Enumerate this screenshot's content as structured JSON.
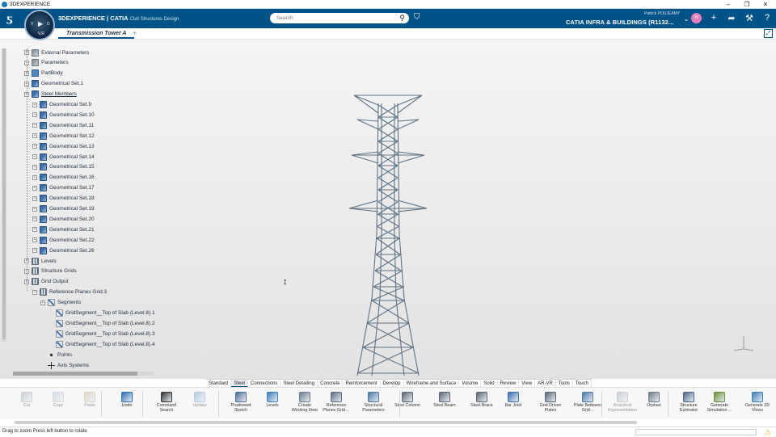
{
  "window": {
    "title": "3DEXPERIENCE",
    "minimize": "–",
    "restore": "❐",
    "close": "✕"
  },
  "header": {
    "brand": "3DEXPERIENCE | CATIA",
    "brand_sub": "Civil Structures Design",
    "search_placeholder": "Search",
    "user_name": "Patrick POUJEAMY",
    "app_name": "CATIA INFRA & BUILDINGS (R1132...",
    "avatar_initials": "H",
    "compass": {
      "left": "V",
      "right": "D",
      "bottom": "V,R"
    }
  },
  "tabs": {
    "document": "Transmission Tower A",
    "add": "+"
  },
  "tree": {
    "items": [
      {
        "label": "External Parameters",
        "level": 1,
        "icon": "param"
      },
      {
        "label": "Parameters",
        "level": 1,
        "icon": "param"
      },
      {
        "label": "PartBody",
        "level": 1,
        "icon": "body"
      },
      {
        "label": "Geometrical Set.1",
        "level": 1,
        "icon": "geo"
      },
      {
        "label": "Steel Members",
        "level": 1,
        "icon": "geo",
        "underline": true
      },
      {
        "label": "Geometrical Set.9",
        "level": 2,
        "icon": "geo"
      },
      {
        "label": "Geometrical Set.10",
        "level": 2,
        "icon": "geo"
      },
      {
        "label": "Geometrical Set.11",
        "level": 2,
        "icon": "geo"
      },
      {
        "label": "Geometrical Set.12",
        "level": 2,
        "icon": "geo"
      },
      {
        "label": "Geometrical Set.13",
        "level": 2,
        "icon": "geo"
      },
      {
        "label": "Geometrical Set.14",
        "level": 2,
        "icon": "geo"
      },
      {
        "label": "Geometrical Set.15",
        "level": 2,
        "icon": "geo"
      },
      {
        "label": "Geometrical Set.16",
        "level": 2,
        "icon": "geo"
      },
      {
        "label": "Geometrical Set.17",
        "level": 2,
        "icon": "geo"
      },
      {
        "label": "Geometrical Set.18",
        "level": 2,
        "icon": "geo"
      },
      {
        "label": "Geometrical Set.19",
        "level": 2,
        "icon": "geo"
      },
      {
        "label": "Geometrical Set.20",
        "level": 2,
        "icon": "geo"
      },
      {
        "label": "Geometrical Set.21",
        "level": 2,
        "icon": "geo"
      },
      {
        "label": "Geometrical Set.22",
        "level": 2,
        "icon": "geo"
      },
      {
        "label": "Geometrical Set.26",
        "level": 2,
        "icon": "geo"
      },
      {
        "label": "Levels",
        "level": 1,
        "icon": "grid"
      },
      {
        "label": "Structure Grids",
        "level": 1,
        "icon": "grid"
      },
      {
        "label": "Grid Output",
        "level": 1,
        "icon": "grid"
      },
      {
        "label": "Reference Planes Grid.3",
        "level": 2,
        "icon": "grid"
      },
      {
        "label": "Segments",
        "level": 3,
        "icon": "seg"
      },
      {
        "label": "GridSegment__Top of Slab (Level.8).1",
        "level": 4,
        "icon": "seg"
      },
      {
        "label": "GridSegment__Top of Slab (Level.8).2",
        "level": 4,
        "icon": "seg"
      },
      {
        "label": "GridSegment__Top of Slab (Level.8).3",
        "level": 4,
        "icon": "seg"
      },
      {
        "label": "GridSegment__Top of Slab (Level.8).4",
        "level": 4,
        "icon": "seg"
      },
      {
        "label": "Points",
        "level": 3,
        "icon": "pts"
      },
      {
        "label": "Axis Systems",
        "level": 3,
        "icon": "axis"
      }
    ]
  },
  "toolbar_tabs": [
    "Standard",
    "Steel",
    "Connections",
    "Steel Detailing",
    "Concrete",
    "Reinforcement",
    "Develop",
    "Wireframe and Surface",
    "Volume",
    "Solid",
    "Review",
    "View",
    "AR-VR",
    "Tools",
    "Touch"
  ],
  "active_toolbar_tab": "Steel",
  "tools": [
    {
      "label": "Cut",
      "icon": "scissors-icon",
      "color": "#8c99a6",
      "disabled": true
    },
    {
      "label": "Copy",
      "icon": "copy-icon",
      "color": "#9fb1c4",
      "disabled": true
    },
    {
      "label": "Paste",
      "icon": "paste-icon",
      "color": "#b9a78c",
      "disabled": true
    },
    {
      "label": "Undo",
      "icon": "undo-icon",
      "color": "#2a6fb0",
      "disabled": false
    },
    {
      "label": "Command Search",
      "icon": "search-icon",
      "color": "#333333",
      "disabled": false
    },
    {
      "label": "Update",
      "icon": "update-icon",
      "color": "#4f8cc9",
      "disabled": true
    },
    {
      "label": "Positioned Sketch",
      "icon": "sketch-icon",
      "color": "#4b6f95",
      "disabled": false
    },
    {
      "label": "Levels",
      "icon": "levels-icon",
      "color": "#3e7fbf",
      "disabled": false
    },
    {
      "label": "Create Working View",
      "icon": "working-view-icon",
      "color": "#6d7f91",
      "disabled": false
    },
    {
      "label": "Reference Planes Grid ...",
      "icon": "grid-icon",
      "color": "#5b6e82",
      "disabled": false
    },
    {
      "label": "Structural Parameters",
      "icon": "structural-params-icon",
      "color": "#4a79a8",
      "disabled": false
    },
    {
      "label": "Steel Column",
      "icon": "column-icon",
      "color": "#5b6878",
      "disabled": false
    },
    {
      "label": "Steel Beam",
      "icon": "beam-icon",
      "color": "#5b6878",
      "disabled": false
    },
    {
      "label": "Steel Brace",
      "icon": "brace-icon",
      "color": "#5b6878",
      "disabled": false
    },
    {
      "label": "Bar Joist",
      "icon": "joist-icon",
      "color": "#3b6cb0",
      "disabled": false
    },
    {
      "label": "Grid Driven Plates",
      "icon": "plates-icon",
      "color": "#5b6878",
      "disabled": false
    },
    {
      "label": "Plate Between Grid...",
      "icon": "plate-icon",
      "color": "#4b7aa8",
      "disabled": false
    },
    {
      "label": "Analytical Representation",
      "icon": "analytical-icon",
      "color": "#8a96a3",
      "disabled": true
    },
    {
      "label": "Orphan",
      "icon": "orphan-icon",
      "color": "#6e7b88",
      "disabled": false
    },
    {
      "label": "Structure Estimator",
      "icon": "estimator-icon",
      "color": "#4c6784",
      "disabled": false
    },
    {
      "label": "Generate Simulation ...",
      "icon": "simulation-icon",
      "color": "#6a8f3a",
      "disabled": false
    },
    {
      "label": "Generate 2D Views",
      "icon": "2d-views-icon",
      "color": "#3d7fb8",
      "disabled": false
    }
  ],
  "status": {
    "text": "Drag to zoom  Press left button to rotate"
  },
  "colors": {
    "header": "#005386",
    "tower": "#5f7386"
  }
}
